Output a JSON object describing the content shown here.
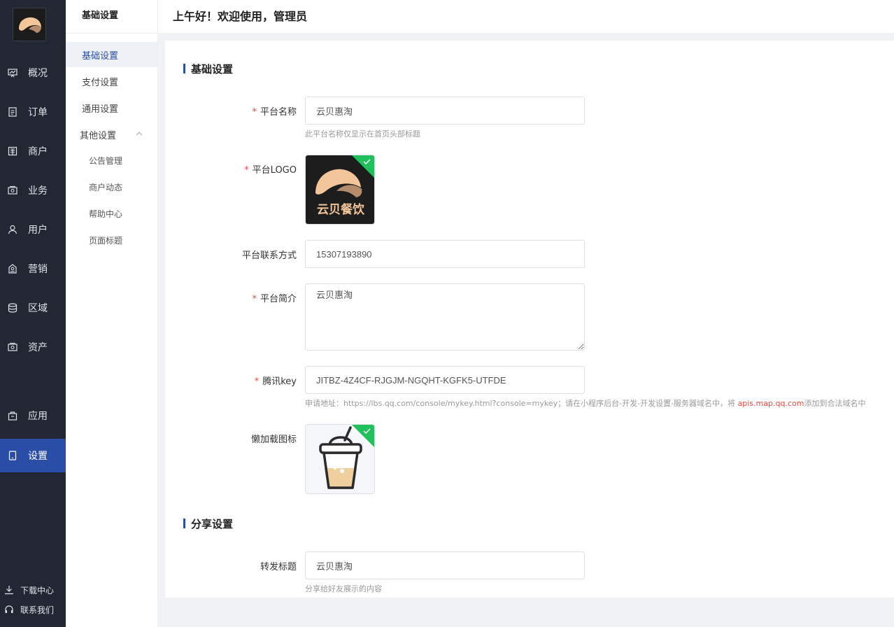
{
  "nav": {
    "items": [
      {
        "label": "概况",
        "icon": "dashboard-icon"
      },
      {
        "label": "订单",
        "icon": "order-icon"
      },
      {
        "label": "商户",
        "icon": "merchant-icon"
      },
      {
        "label": "业务",
        "icon": "business-icon"
      },
      {
        "label": "用户",
        "icon": "user-icon"
      },
      {
        "label": "营销",
        "icon": "marketing-icon"
      },
      {
        "label": "区域",
        "icon": "database-icon"
      },
      {
        "label": "资产",
        "icon": "wallet-icon"
      },
      {
        "label": "应用",
        "icon": "bag-icon"
      },
      {
        "label": "设置",
        "icon": "tablet-icon"
      }
    ],
    "active": "设置",
    "footer": {
      "download": "下载中心",
      "contact": "联系我们"
    }
  },
  "subnav": {
    "title": "基础设置",
    "items": [
      "基础设置",
      "支付设置",
      "通用设置"
    ],
    "group": {
      "label": "其他设置",
      "children": [
        "公告管理",
        "商户动态",
        "帮助中心",
        "页面标题"
      ]
    }
  },
  "header": {
    "greeting": "上午好！欢迎使用，管理员"
  },
  "form": {
    "basic": {
      "title": "基础设置",
      "platform_name": {
        "label": "平台名称",
        "value": "云贝惠淘",
        "hint": "此平台名称仅显示在首页头部标题"
      },
      "platform_logo": {
        "label": "平台LOGO",
        "logo_text": "云贝餐饮"
      },
      "platform_contact": {
        "label": "平台联系方式",
        "value": "15307193890"
      },
      "platform_intro": {
        "label": "平台简介",
        "value": "云贝惠淘"
      },
      "tencent_key": {
        "label": "腾讯key",
        "value": "JITBZ-4Z4CF-RJGJM-NGQHT-KGFK5-UTFDE",
        "hint_prefix": "申请地址：https://lbs.qq.com/console/mykey.html?console=mykey；请在小程序后台-开发-开发设置-服务器域名中，将 ",
        "hint_link": "apis.map.qq.com",
        "hint_suffix": "添加到合法域名中"
      },
      "lazy_icon": {
        "label": "懒加载图标"
      }
    },
    "share": {
      "title": "分享设置",
      "share_title": {
        "label": "转发标题",
        "value": "云贝惠淘",
        "hint": "分享给好友展示的内容"
      }
    }
  },
  "colors": {
    "sidebar": "#222733",
    "primary": "#2a4ea7",
    "required": "#f0463a",
    "badge": "#20c05c"
  }
}
